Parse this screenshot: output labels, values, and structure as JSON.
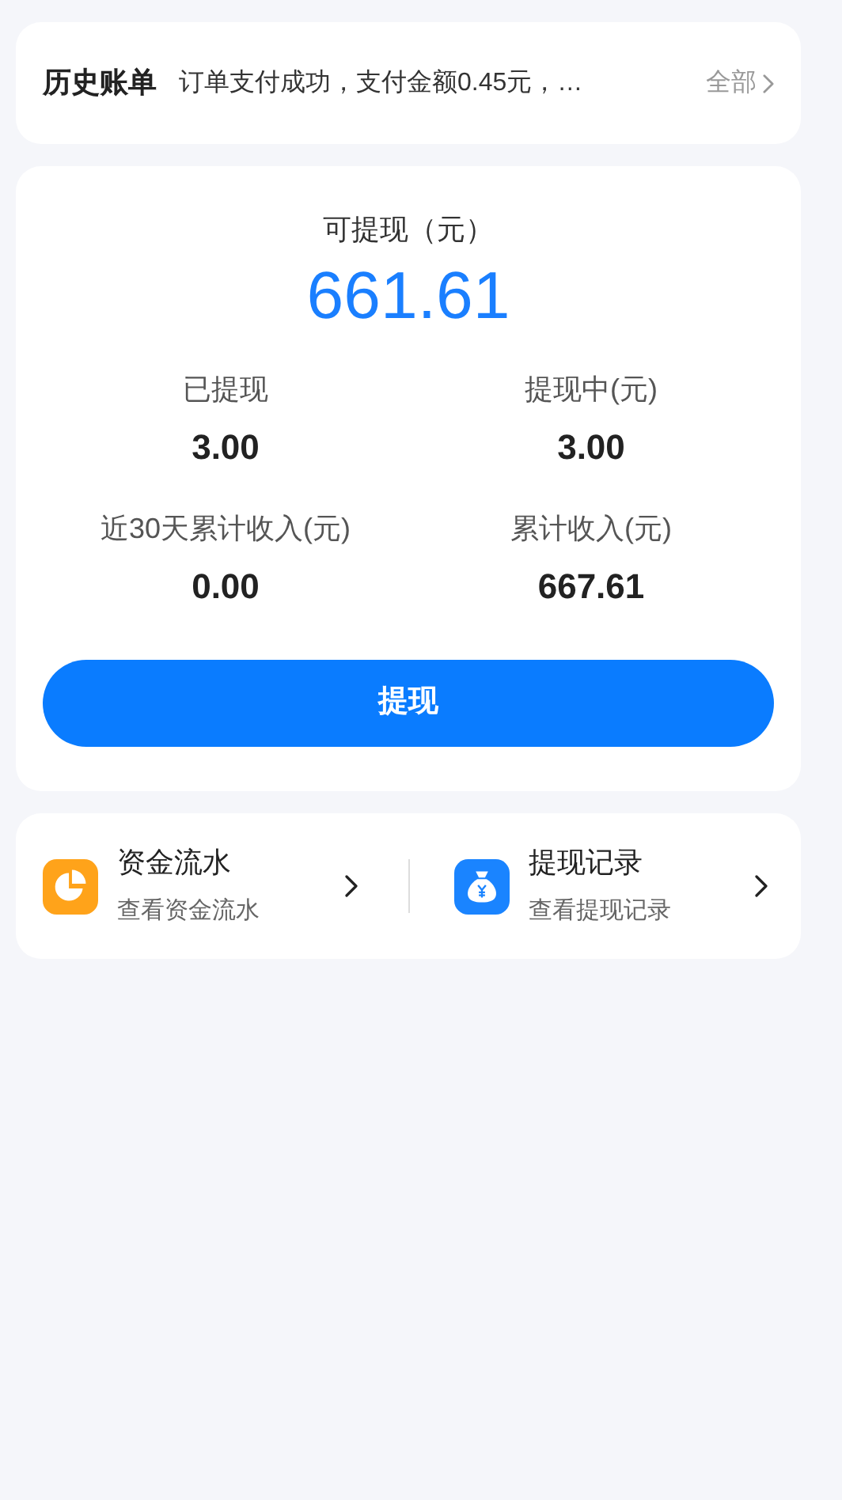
{
  "history": {
    "title": "历史账单",
    "message": "订单支付成功，支付金额0.45元，…",
    "all_link": "全部"
  },
  "balance": {
    "label": "可提现（元）",
    "amount": "661.61",
    "stats": [
      {
        "label": "已提现",
        "value": "3.00"
      },
      {
        "label": "提现中(元)",
        "value": "3.00"
      },
      {
        "label": "近30天累计收入(元)",
        "value": "0.00"
      },
      {
        "label": "累计收入(元)",
        "value": "667.61"
      }
    ],
    "button": "提现"
  },
  "shortcuts": [
    {
      "kind": "flow",
      "title": "资金流水",
      "subtitle": "查看资金流水"
    },
    {
      "kind": "withdraw",
      "title": "提现记录",
      "subtitle": "查看提现记录"
    }
  ]
}
